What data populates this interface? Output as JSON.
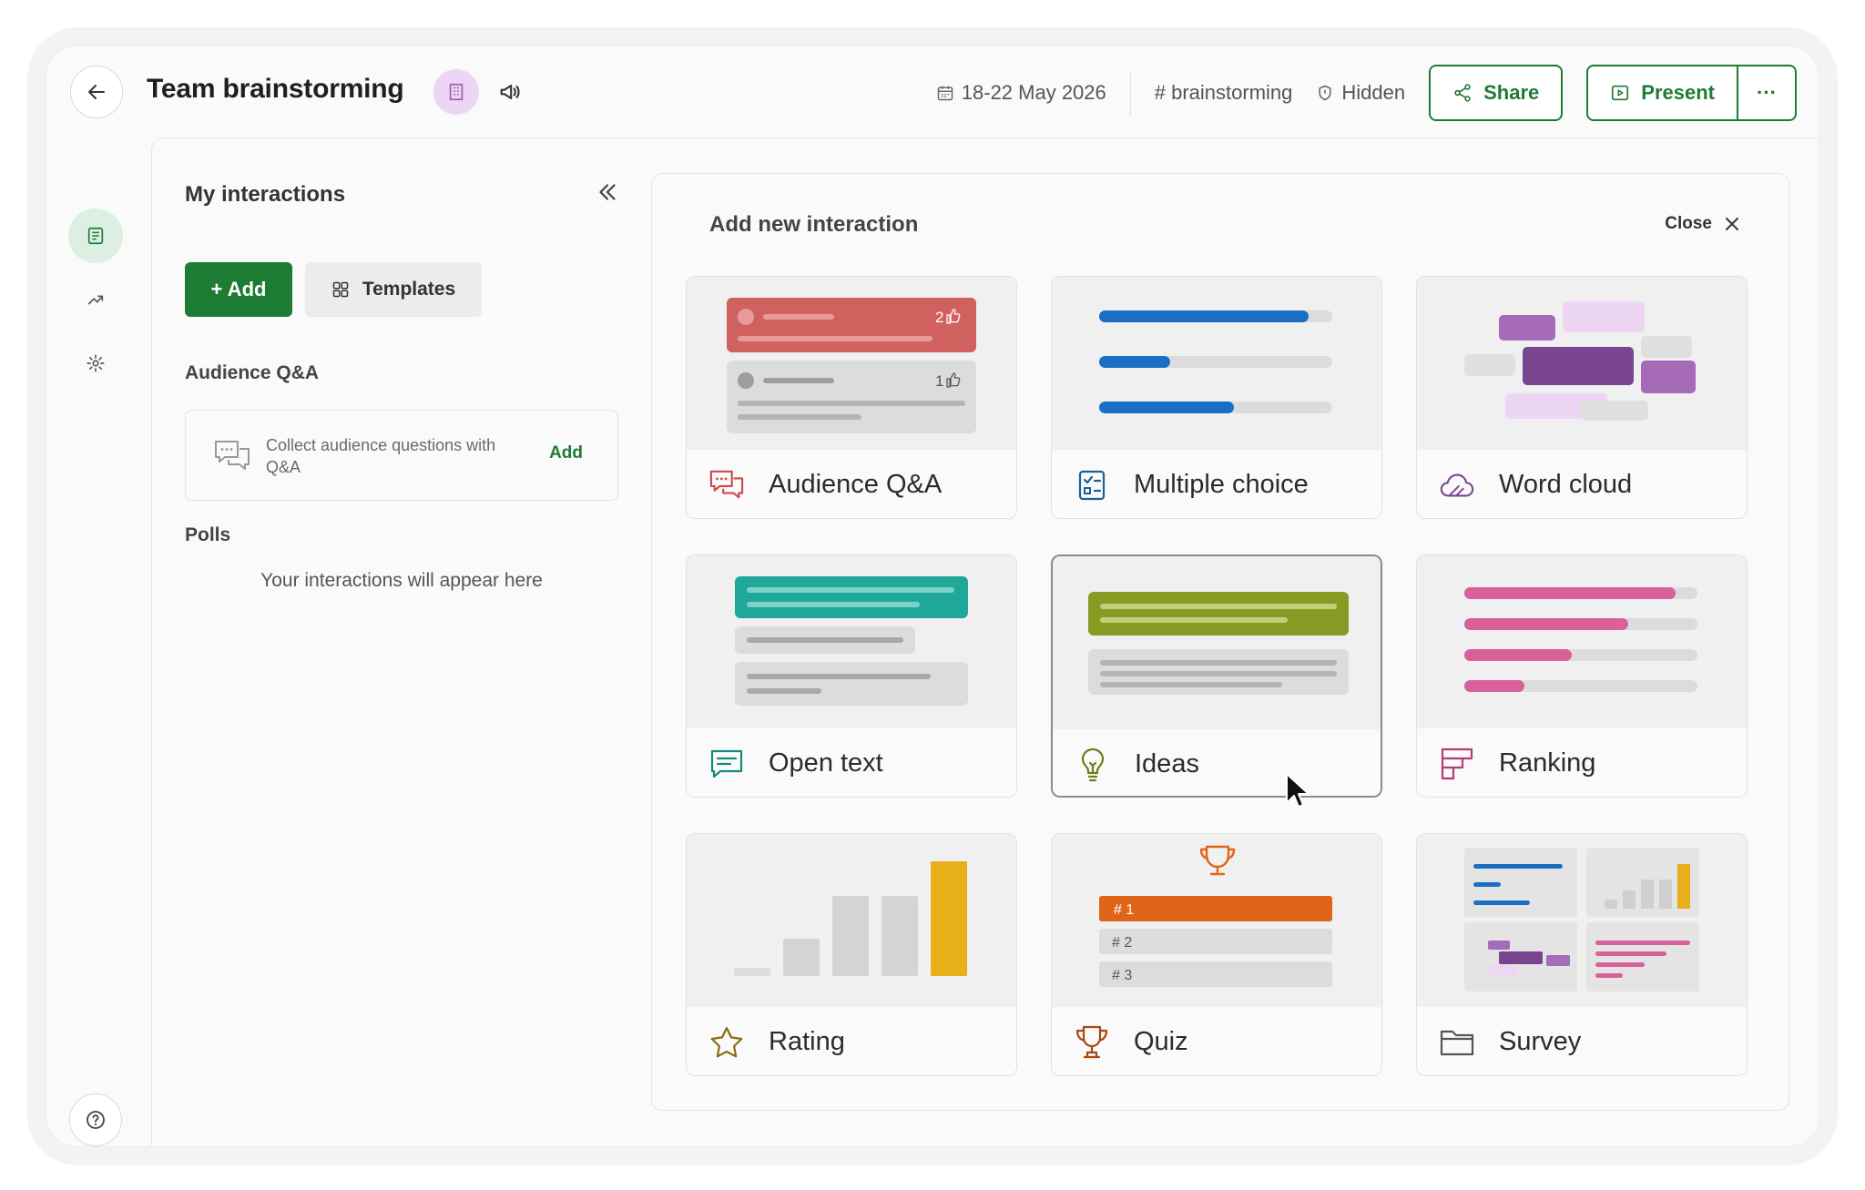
{
  "header": {
    "title": "Team brainstorming",
    "date": "18-22 May 2026",
    "tag": "# brainstorming",
    "visibility": "Hidden",
    "share_label": "Share",
    "present_label": "Present",
    "more_label": "···"
  },
  "panel": {
    "title": "My interactions",
    "add_label": "+ Add",
    "templates_label": "Templates",
    "qa_section": "Audience Q&A",
    "qa_card_text": "Collect audience questions with Q&A",
    "qa_card_add": "Add",
    "polls_section": "Polls",
    "empty_text": "Your interactions will appear here"
  },
  "add_new": {
    "title": "Add new interaction",
    "close_label": "Close",
    "cards": [
      {
        "label": "Audience Q&A",
        "icon": "chat-bubbles-icon",
        "likes_1": "2",
        "likes_2": "1"
      },
      {
        "label": "Multiple choice",
        "icon": "checklist-icon"
      },
      {
        "label": "Word cloud",
        "icon": "cloud-icon"
      },
      {
        "label": "Open text",
        "icon": "message-lines-icon"
      },
      {
        "label": "Ideas",
        "icon": "lightbulb-icon"
      },
      {
        "label": "Ranking",
        "icon": "ranking-bars-icon"
      },
      {
        "label": "Rating",
        "icon": "star-icon"
      },
      {
        "label": "Quiz",
        "icon": "trophy-icon",
        "rank_1": "# 1",
        "rank_2": "# 2",
        "rank_3": "# 3"
      },
      {
        "label": "Survey",
        "icon": "folder-icon"
      }
    ]
  },
  "colors": {
    "brand_green": "#1e7b34",
    "qa_red": "#d0615f",
    "mc_blue": "#1a6fc4",
    "wordcloud_purple": "#7a4590",
    "opentext_teal": "#1fa89a",
    "ideas_olive": "#879b24",
    "ranking_pink": "#d9609b",
    "rating_gold": "#e7b01a",
    "quiz_orange": "#e0651a"
  }
}
